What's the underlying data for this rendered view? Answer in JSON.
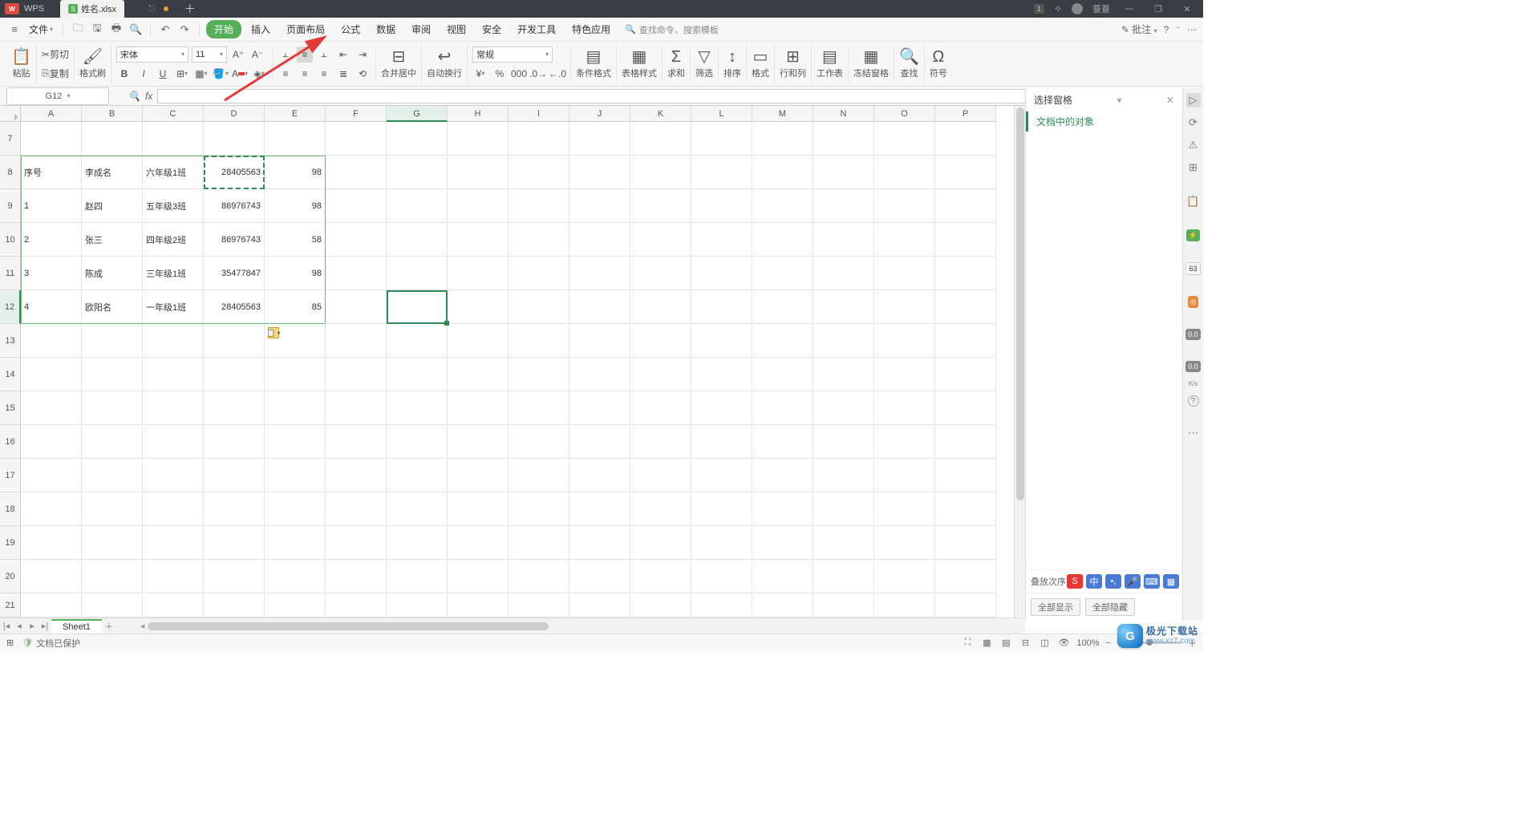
{
  "title": {
    "app": "WPS",
    "file": "姓名.xlsx",
    "badge": "1",
    "user": "薏薏"
  },
  "menu": {
    "file": "文件",
    "items": [
      "开始",
      "插入",
      "页面布局",
      "公式",
      "数据",
      "审阅",
      "视图",
      "安全",
      "开发工具",
      "特色应用"
    ],
    "search_placeholder": "查找命令、搜索模板",
    "comment": "批注"
  },
  "ribbon": {
    "paste": "粘贴",
    "cut": "剪切",
    "copy": "复制",
    "fmt_paint": "格式刷",
    "font": "宋体",
    "size": "11",
    "merge": "合并居中",
    "wrap": "自动换行",
    "num_fmt": "常规",
    "cond_fmt": "条件格式",
    "tbl_style": "表格样式",
    "sum": "求和",
    "filter": "筛选",
    "sort": "排序",
    "format": "格式",
    "rowcol": "行和列",
    "sheet": "工作表",
    "freeze": "冻结窗格",
    "find": "查找",
    "symbol": "符号"
  },
  "formula": {
    "name_box": "G12",
    "fx": "fx"
  },
  "columns": [
    "A",
    "B",
    "C",
    "D",
    "E",
    "F",
    "G",
    "H",
    "I",
    "J",
    "K",
    "L",
    "M",
    "N",
    "O",
    "P"
  ],
  "rows_visible": [
    7,
    8,
    9,
    10,
    11,
    12,
    13,
    14,
    15,
    16,
    17,
    18,
    19,
    20,
    21
  ],
  "data": {
    "r8": {
      "A": "序号",
      "B": "李成名",
      "C": "六年级1班",
      "D": "28405563",
      "E": "98"
    },
    "r9": {
      "A": "1",
      "B": "赵四",
      "C": "五年级3班",
      "D": "86976743",
      "E": "98"
    },
    "r10": {
      "A": "2",
      "B": "张三",
      "C": "四年级2班",
      "D": "86976743",
      "E": "58"
    },
    "r11": {
      "A": "3",
      "B": "陈成",
      "C": "三年级1班",
      "D": "35477847",
      "E": "98"
    },
    "r12": {
      "A": "4",
      "B": "欧阳名",
      "C": "一年级1班",
      "D": "28405563",
      "E": "85"
    }
  },
  "panel": {
    "title": "选择窗格",
    "subtitle": "文档中的对象",
    "order_label": "叠放次序",
    "show_all": "全部显示",
    "hide_all": "全部隐藏"
  },
  "sheet": {
    "name": "Sheet1"
  },
  "status": {
    "protect": "文档已保护",
    "zoom": "100%"
  },
  "side_badges": {
    "pct": "63",
    "val1": "0.0",
    "val2": "0.0",
    "unit": "K/s",
    "q": "?"
  },
  "ime": {
    "lang": "中"
  },
  "watermark": {
    "brand": "极光下载站",
    "url": "www.xz7.com"
  }
}
